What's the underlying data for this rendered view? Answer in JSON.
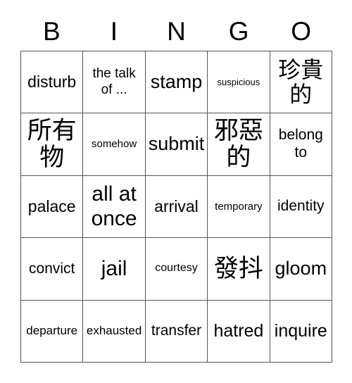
{
  "card": {
    "title": "BINGO",
    "header_letters": [
      "B",
      "I",
      "N",
      "G",
      "O"
    ],
    "grid_size": "5x5",
    "colors": {
      "background": "#ffffff",
      "text": "#000000",
      "border": "#555555"
    },
    "rows": [
      [
        {
          "text": "disturb",
          "size": "sz-l2",
          "cjk": false
        },
        {
          "text": "the talk of ...",
          "size": "sz-m2",
          "cjk": false
        },
        {
          "text": "stamp",
          "size": "sz-xl2",
          "cjk": false
        },
        {
          "text": "suspicious",
          "size": "sz-xs",
          "cjk": false
        },
        {
          "text": "珍貴的",
          "size": "sz-cjk",
          "cjk": true
        }
      ],
      [
        {
          "text": "所有物",
          "size": "sz-cjk2",
          "cjk": true
        },
        {
          "text": "somehow",
          "size": "sz-s",
          "cjk": false
        },
        {
          "text": "submit",
          "size": "sz-xl2",
          "cjk": false
        },
        {
          "text": "邪惡的",
          "size": "sz-cjk2",
          "cjk": true
        },
        {
          "text": "belong to",
          "size": "sz-l",
          "cjk": false
        }
      ],
      [
        {
          "text": "palace",
          "size": "sz-l2",
          "cjk": false
        },
        {
          "text": "all at once",
          "size": "sz-xxl",
          "cjk": false
        },
        {
          "text": "arrival",
          "size": "sz-l2",
          "cjk": false
        },
        {
          "text": "temporary",
          "size": "sz-s",
          "cjk": false
        },
        {
          "text": "identity",
          "size": "sz-l",
          "cjk": false
        }
      ],
      [
        {
          "text": "convict",
          "size": "sz-l",
          "cjk": false
        },
        {
          "text": "jail",
          "size": "sz-xxl",
          "cjk": false
        },
        {
          "text": "courtesy",
          "size": "sz-s2",
          "cjk": false
        },
        {
          "text": "發抖",
          "size": "sz-cjk2",
          "cjk": true
        },
        {
          "text": "gloom",
          "size": "sz-xl2",
          "cjk": false
        }
      ],
      [
        {
          "text": "departure",
          "size": "sz-m",
          "cjk": false
        },
        {
          "text": "exhausted",
          "size": "sz-m",
          "cjk": false
        },
        {
          "text": "transfer",
          "size": "sz-l",
          "cjk": false
        },
        {
          "text": "hatred",
          "size": "sz-xl",
          "cjk": false
        },
        {
          "text": "inquire",
          "size": "sz-xl",
          "cjk": false
        }
      ]
    ]
  }
}
